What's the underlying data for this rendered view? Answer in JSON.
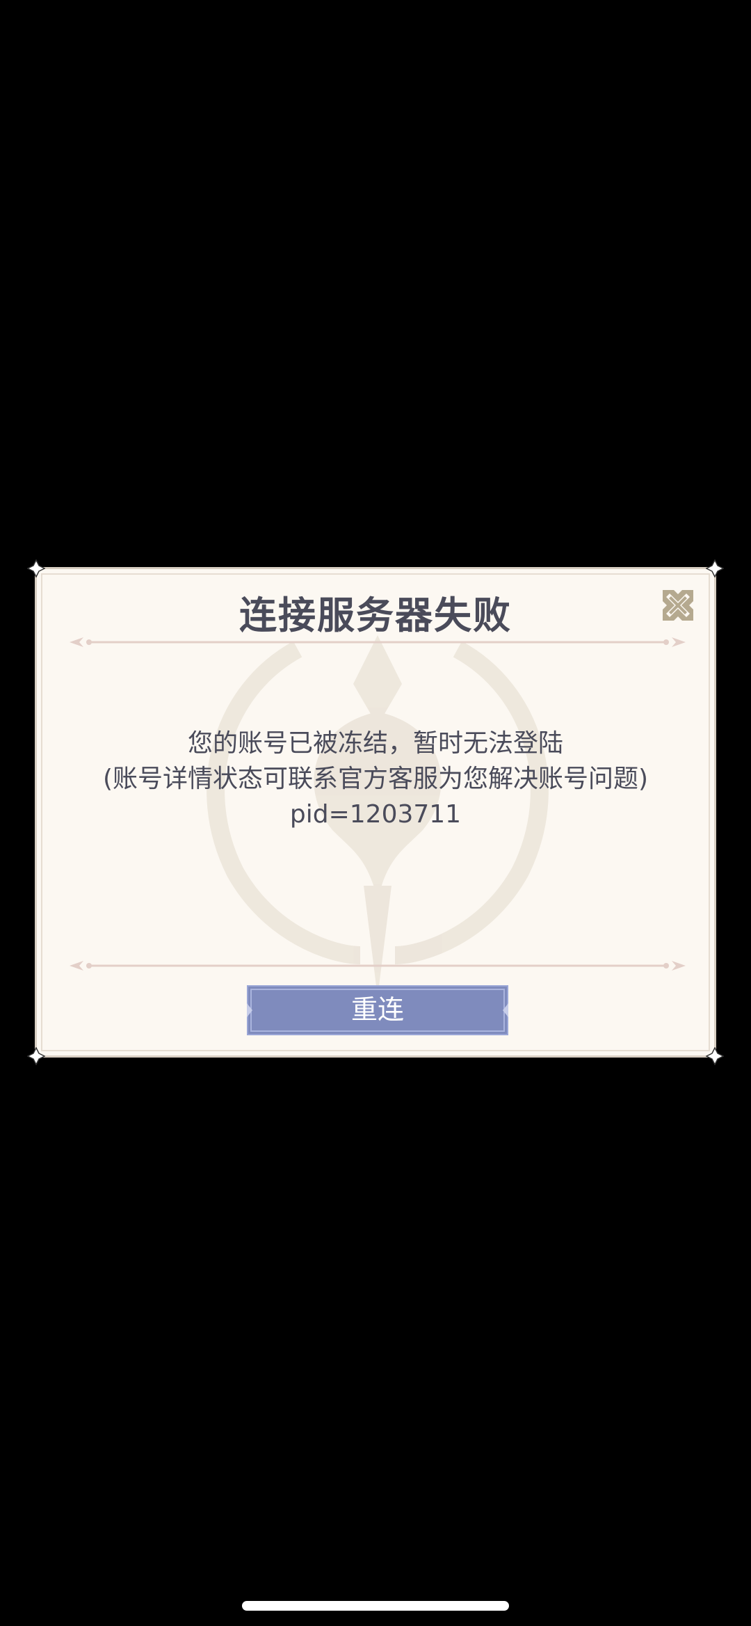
{
  "dialog": {
    "title": "连接服务器失败",
    "message_lines": [
      "您的账号已被冻结，暂时无法登陆",
      "(账号详情状态可联系官方客服为您解决账号问题)",
      "pid=1203711"
    ],
    "retry_label": "重连",
    "close_icon": "close-x-icon"
  },
  "colors": {
    "background": "#000000",
    "dialog_bg": "#fcf8f2",
    "title_text": "#4a4b5a",
    "button_bg": "#7f8bbd",
    "close_icon": "#b5a98f"
  }
}
